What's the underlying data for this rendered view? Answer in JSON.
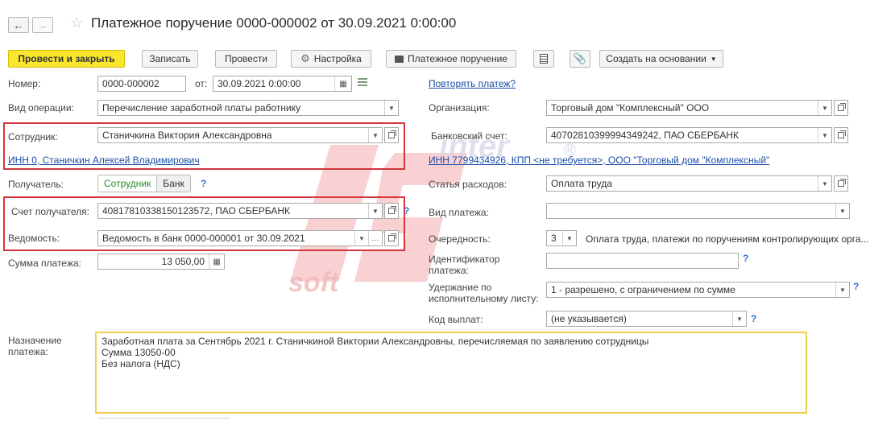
{
  "window": {
    "title": "Платежное поручение 0000-000002 от 30.09.2021 0:00:00"
  },
  "toolbar": {
    "post_close": "Провести и закрыть",
    "save": "Записать",
    "post": "Провести",
    "settings": "Настройка",
    "print_order": "Платежное поручение",
    "create_based": "Создать на основании"
  },
  "form": {
    "number_label": "Номер:",
    "number_value": "0000-000002",
    "date_label": "от:",
    "date_value": "30.09.2021  0:00:00",
    "repeat_link": "Повторять платеж?",
    "operation_label": "Вид операции:",
    "operation_value": "Перечисление заработной платы работнику",
    "org_label": "Организация:",
    "org_value": "Торговый дом \"Комплексный\" ООО",
    "employee_label": "Сотрудник:",
    "employee_value": "Станичкина Виктория Александровна",
    "bank_account_label": "Банковский счет:",
    "bank_account_value": "40702810399994349242, ПАО СБЕРБАНК",
    "inn_employee_link": "ИНН 0, Станичкин Алексей Владимирович",
    "inn_org_link": "ИНН 7799434926, КПП <не требуется>, ООО \"Торговый дом \"Комплексный\"",
    "recipient_label": "Получатель:",
    "recipient_opt_employee": "Сотрудник",
    "recipient_opt_bank": "Банк",
    "expense_label": "Статья расходов:",
    "expense_value": "Оплата труда",
    "recipient_account_label": "Счет получателя:",
    "recipient_account_value": "40817810338150123572, ПАО СБЕРБАНК",
    "payment_type_label": "Вид платежа:",
    "payment_type_value": "",
    "statement_label": "Ведомость:",
    "statement_value": "Ведомость в банк 0000-000001 от 30.09.2021",
    "priority_label": "Очередность:",
    "priority_value": "3",
    "priority_desc": "Оплата труда, платежи по поручениям контролирующих орга...",
    "amount_label": "Сумма платежа:",
    "amount_value": "13 050,00",
    "payment_id_label_1": "Идентификатор",
    "payment_id_label_2": "платежа:",
    "payment_id_value": "",
    "withholding_label_1": "Удержание по",
    "withholding_label_2": "исполнительному листу:",
    "withholding_value": "1 - разрешено, с ограничением по сумме",
    "payout_code_label": "Код выплат:",
    "payout_code_value": "(не указывается)",
    "purpose_label_1": "Назначение",
    "purpose_label_2": "платежа:",
    "purpose_text": "Заработная плата за Сентябрь 2021 г. Станичкиной Виктории Александровны, перечисляемая по заявлению сотрудницы\nСумма 13050-00\nБез налога (НДС)",
    "help_mark": "?"
  },
  "watermark": {
    "text_inter": "inter",
    "text_soft": "soft",
    "registered": "®"
  },
  "colors": {
    "primary_button": "#fbe62e",
    "highlight_box": "#d2363d",
    "link": "#1a4ea8",
    "help": "#2c6fd1"
  }
}
